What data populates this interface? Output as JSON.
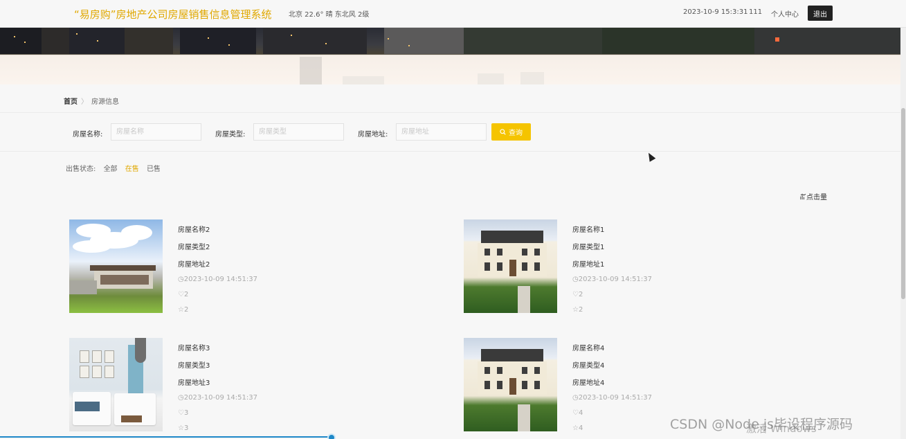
{
  "header": {
    "title": "“易房购”房地产公司房屋销售信息管理系统",
    "weather": "北京  22.6°  晴  东北风  2级",
    "datetime": "2023-10-9 15:3:31",
    "user_count": "111",
    "profile_label": "个人中心",
    "logout_label": "退出"
  },
  "breadcrumb": {
    "home": "首页",
    "separator": "〉",
    "current": "房源信息"
  },
  "search": {
    "name_label": "房屋名称:",
    "name_placeholder": "房屋名称",
    "type_label": "房屋类型:",
    "type_placeholder": "房屋类型",
    "address_label": "房屋地址:",
    "address_placeholder": "房屋地址",
    "button_label": "查询"
  },
  "status_filter": {
    "label": "出售状态:",
    "options": [
      "全部",
      "在售",
      "已售"
    ],
    "active": "在售"
  },
  "sort": {
    "label": "点击量"
  },
  "listings": [
    {
      "name": "房屋名称2",
      "type": "房屋类型2",
      "address": "房屋地址2",
      "time": "2023-10-09 14:51:37",
      "likes": "2",
      "favorites": "2",
      "photo": "modern-villa"
    },
    {
      "name": "房屋名称1",
      "type": "房屋类型1",
      "address": "房屋地址1",
      "time": "2023-10-09 14:51:37",
      "likes": "2",
      "favorites": "2",
      "photo": "colonial-house"
    },
    {
      "name": "房屋名称3",
      "type": "房屋类型3",
      "address": "房屋地址3",
      "time": "2023-10-09 14:51:37",
      "likes": "3",
      "favorites": "3",
      "photo": "bedroom"
    },
    {
      "name": "房屋名称4",
      "type": "房屋类型4",
      "address": "房屋地址4",
      "time": "2023-10-09 14:51:37",
      "likes": "4",
      "favorites": "4",
      "photo": "colonial-house"
    }
  ],
  "overlay": {
    "watermark": "CSDN @Node.js毕设程序源码",
    "windows_activation": "激活 Windows"
  },
  "colors": {
    "accent": "#f5c400",
    "title": "#e0a800",
    "logout_bg": "#222222"
  }
}
